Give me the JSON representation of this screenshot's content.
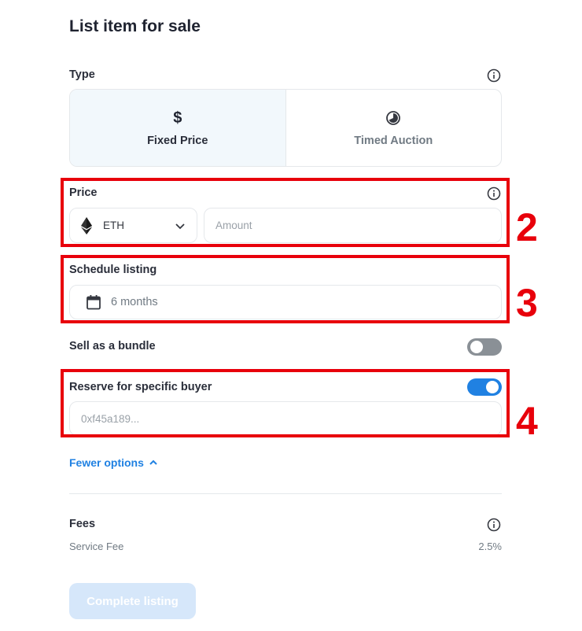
{
  "page": {
    "title": "List item for sale"
  },
  "type_section": {
    "label": "Type",
    "options": [
      {
        "icon": "$",
        "label": "Fixed Price",
        "selected": true
      },
      {
        "icon": "clock-icon",
        "label": "Timed Auction",
        "selected": false
      }
    ]
  },
  "price_section": {
    "label": "Price",
    "currency": "ETH",
    "currency_icon": "ethereum-icon",
    "amount_placeholder": "Amount",
    "amount_value": ""
  },
  "schedule_section": {
    "label": "Schedule listing",
    "duration": "6 months"
  },
  "bundle_section": {
    "label": "Sell as a bundle",
    "enabled": false
  },
  "reserve_section": {
    "label": "Reserve for specific buyer",
    "enabled": true,
    "address_placeholder": "0xf45a189..."
  },
  "fewer_options": {
    "label": "Fewer options"
  },
  "fees_section": {
    "label": "Fees",
    "service_fee_label": "Service Fee",
    "service_fee_value": "2.5%"
  },
  "complete_button": {
    "label": "Complete listing"
  },
  "annotations": [
    {
      "number": "2"
    },
    {
      "number": "3"
    },
    {
      "number": "4"
    }
  ],
  "colors": {
    "accent": "#2081e2",
    "annotation": "#e8000b",
    "selected_bg": "#f2f8fc",
    "disabled_button": "#d6e7fa"
  }
}
